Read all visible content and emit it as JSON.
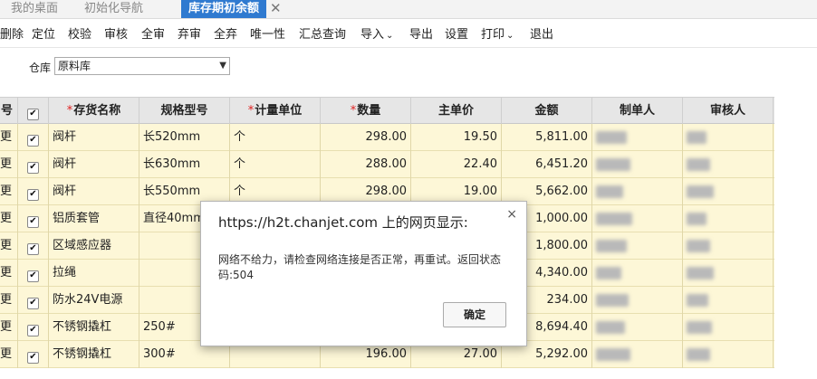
{
  "tabs": [
    {
      "label": "我的桌面"
    },
    {
      "label": "初始化导航"
    },
    {
      "label": "库存期初余额",
      "active": true
    }
  ],
  "toolbar": [
    {
      "label": "删除"
    },
    {
      "label": "定位"
    },
    {
      "label": "校验"
    },
    {
      "label": "审核"
    },
    {
      "label": "全审"
    },
    {
      "label": "弃审"
    },
    {
      "label": "全弃"
    },
    {
      "label": "唯一性"
    },
    {
      "label": "汇总查询"
    },
    {
      "label": "导入",
      "dropdown": true
    },
    {
      "label": "导出"
    },
    {
      "label": "设置"
    },
    {
      "label": "打印",
      "dropdown": true
    },
    {
      "label": "退出"
    }
  ],
  "filter": {
    "label": "仓库",
    "value": "原料库"
  },
  "grid": {
    "columns": [
      "号",
      "",
      "存货名称",
      "规格型号",
      "计量单位",
      "数量",
      "主单价",
      "金额",
      "制单人",
      "审核人"
    ],
    "required_columns": [
      "存货名称",
      "计量单位",
      "数量"
    ],
    "rows": [
      {
        "idx": "更",
        "name": "阀杆",
        "spec": "长520mm",
        "unit": "个",
        "qty": "298.00",
        "price": "19.50",
        "amount": "5,811.00"
      },
      {
        "idx": "更",
        "name": "阀杆",
        "spec": "长630mm",
        "unit": "个",
        "qty": "288.00",
        "price": "22.40",
        "amount": "6,451.20"
      },
      {
        "idx": "更",
        "name": "阀杆",
        "spec": "长550mm",
        "unit": "个",
        "qty": "298.00",
        "price": "19.00",
        "amount": "5,662.00"
      },
      {
        "idx": "更",
        "name": "铝质套管",
        "spec": "直径40mm",
        "unit": "",
        "qty": "",
        "price": "",
        "amount": "1,000.00"
      },
      {
        "idx": "更",
        "name": "区域感应器",
        "spec": "",
        "unit": "",
        "qty": "",
        "price": "",
        "amount": "1,800.00"
      },
      {
        "idx": "更",
        "name": "拉绳",
        "spec": "",
        "unit": "",
        "qty": "",
        "price": "",
        "amount": "4,340.00"
      },
      {
        "idx": "更",
        "name": "防水24V电源",
        "spec": "",
        "unit": "",
        "qty": "",
        "price": "",
        "amount": "234.00"
      },
      {
        "idx": "更",
        "name": "不锈钢撬杠",
        "spec": "250#",
        "unit": "",
        "qty": "",
        "price": "",
        "amount": "8,694.40"
      },
      {
        "idx": "更",
        "name": "不锈钢撬杠",
        "spec": "300#",
        "unit": "",
        "qty": "196.00",
        "price": "27.00",
        "amount": "5,292.00"
      }
    ]
  },
  "dialog": {
    "title": "https://h2t.chanjet.com 上的网页显示:",
    "close": "×",
    "message": "网络不给力，请检查网络连接是否正常，再重试。返回状态码:504",
    "ok": "确定"
  }
}
